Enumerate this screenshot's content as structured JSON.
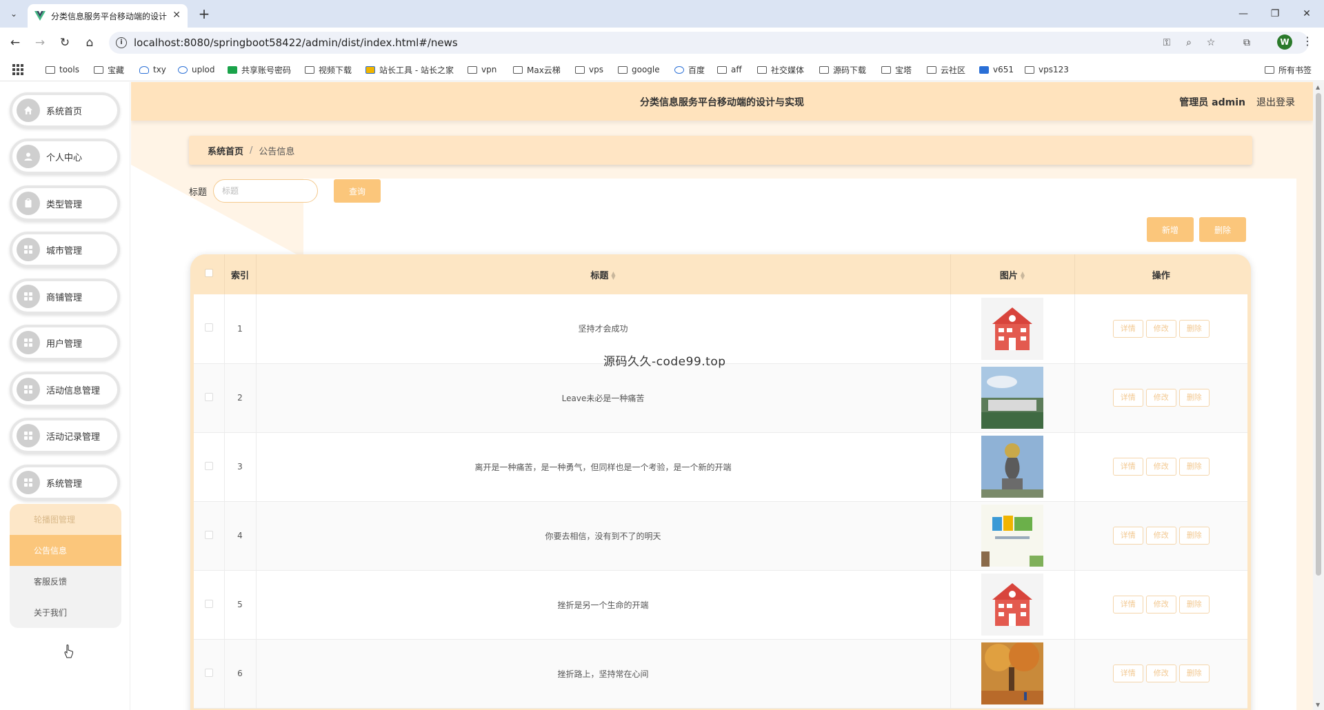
{
  "browser": {
    "tab_title": "分类信息服务平台移动端的设计",
    "url": "localhost:8080/springboot58422/admin/dist/index.html#/news",
    "profile_initial": "W",
    "bookmarks": [
      "tools",
      "宝藏",
      "txy",
      "uplod",
      "共享账号密码",
      "视频下载",
      "站长工具 - 站长之家",
      "vpn",
      "Max云梯",
      "vps",
      "google",
      "百度",
      "aff",
      "社交媒体",
      "源码下载",
      "宝塔",
      "云社区",
      "v651",
      "vps123"
    ],
    "all_bookmarks": "所有书签"
  },
  "header": {
    "title": "分类信息服务平台移动端的设计与实现",
    "user": "管理员 admin",
    "logout": "退出登录"
  },
  "sidebar": {
    "items": [
      {
        "label": "系统首页",
        "icon": "home-icon"
      },
      {
        "label": "个人中心",
        "icon": "user-icon"
      },
      {
        "label": "类型管理",
        "icon": "clipboard-icon"
      },
      {
        "label": "城市管理",
        "icon": "grid-icon"
      },
      {
        "label": "商铺管理",
        "icon": "grid-icon"
      },
      {
        "label": "用户管理",
        "icon": "grid-icon"
      },
      {
        "label": "活动信息管理",
        "icon": "grid-icon"
      },
      {
        "label": "活动记录管理",
        "icon": "grid-icon"
      },
      {
        "label": "系统管理",
        "icon": "grid-icon"
      }
    ],
    "submenu": [
      "轮播图管理",
      "公告信息",
      "客服反馈",
      "关于我们"
    ]
  },
  "breadcrumb": {
    "home": "系统首页",
    "sep": "/",
    "current": "公告信息"
  },
  "search": {
    "label": "标题",
    "placeholder": "标题",
    "button": "查询"
  },
  "actions": {
    "add": "新增",
    "delete": "删除"
  },
  "table": {
    "columns": {
      "index": "索引",
      "title": "标题",
      "image": "图片",
      "ops": "操作"
    },
    "op_labels": {
      "detail": "详情",
      "edit": "修改",
      "delete": "删除"
    },
    "rows": [
      {
        "index": "1",
        "title": "坚持才会成功",
        "image": "school-building"
      },
      {
        "index": "2",
        "title": "Leave未必是一种痛苦",
        "image": "campus-landscape"
      },
      {
        "index": "3",
        "title": "离开是一种痛苦，是一种勇气，但同样也是一个考验，是一个新的开端",
        "image": "globe-sculpture"
      },
      {
        "index": "4",
        "title": "你要去相信，没有到不了的明天",
        "image": "study-poster"
      },
      {
        "index": "5",
        "title": "挫折是另一个生命的开端",
        "image": "school-building"
      },
      {
        "index": "6",
        "title": "挫折路上，坚持常在心间",
        "image": "autumn-tree"
      }
    ]
  },
  "watermark": "源码久久-code99.top",
  "colors": {
    "accent": "#fbc67b",
    "header_bg": "#ffe3bd",
    "table_head": "#fde6c4"
  }
}
